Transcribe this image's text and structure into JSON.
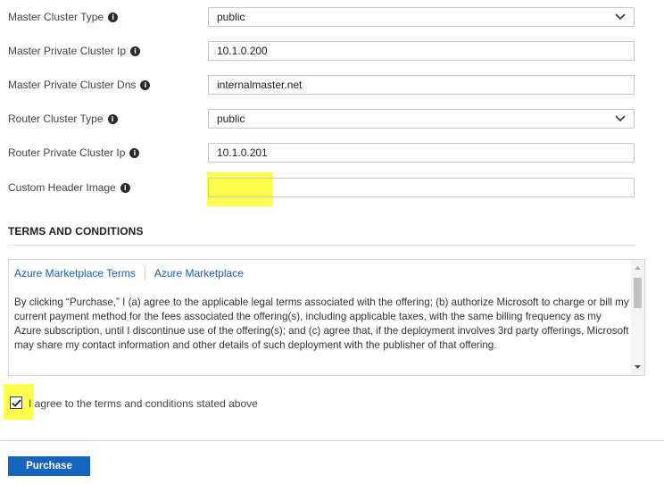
{
  "form": {
    "master_cluster_type": {
      "label": "Master Cluster Type",
      "value": "public"
    },
    "master_private_cluster_ip": {
      "label": "Master Private Cluster Ip",
      "value": "10.1.0.200"
    },
    "master_private_cluster_dns": {
      "label": "Master Private Cluster Dns",
      "value": "internalmaster.net"
    },
    "router_cluster_type": {
      "label": "Router Cluster Type",
      "value": "public"
    },
    "router_private_cluster_ip": {
      "label": "Router Private Cluster Ip",
      "value": "10.1.0.201"
    },
    "custom_header_image": {
      "label": "Custom Header Image",
      "value": ""
    }
  },
  "terms": {
    "title": "TERMS AND CONDITIONS",
    "link1": "Azure Marketplace Terms",
    "link2": "Azure Marketplace",
    "body": "By clicking “Purchase,” I (a) agree to the applicable legal terms associated with the offering; (b) authorize Microsoft to charge or bill my current payment method for the fees associated the offering(s), including applicable taxes, with the same billing frequency as my Azure subscription, until I discontinue use of the offering(s); and (c) agree that, if the deployment involves 3rd party offerings, Microsoft may share my contact information and other details of such deployment with the publisher of that offering."
  },
  "agree": {
    "label": "I agree to the terms and conditions stated above",
    "checked": true
  },
  "purchase_label": "Purchase",
  "colors": {
    "highlight": "#ffff2e",
    "primary": "#1565c0",
    "link": "#1a5fb4"
  },
  "icons": {
    "info": "info-icon",
    "dropdown": "chevron-down-icon",
    "check": "checkmark-icon"
  }
}
